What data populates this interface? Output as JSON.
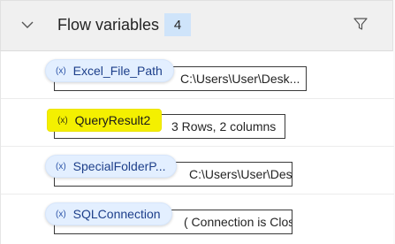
{
  "header": {
    "title": "Flow variables",
    "count": "4",
    "collapse_icon": "chevron-down-icon",
    "filter_icon": "filter-icon"
  },
  "variables": [
    {
      "icon_text": "(x)",
      "name": "Excel_File_Path",
      "value": "C:\\Users\\User\\Desk...",
      "highlighted": false
    },
    {
      "icon_text": "(x)",
      "name": "QueryResult2",
      "value": "3 Rows, 2 columns",
      "highlighted": true
    },
    {
      "icon_text": "(x)",
      "name": "SpecialFolderP...",
      "value": "C:\\Users\\User\\Desk...",
      "highlighted": false
    },
    {
      "icon_text": "(x)",
      "name": "SQLConnection",
      "value": "( Connection is Clos...",
      "highlighted": false
    }
  ],
  "colors": {
    "header_bg": "#f0f0f0",
    "badge_bg": "#cfe4fa",
    "pill_bg": "#e3efff",
    "highlight": "#f4f000"
  }
}
